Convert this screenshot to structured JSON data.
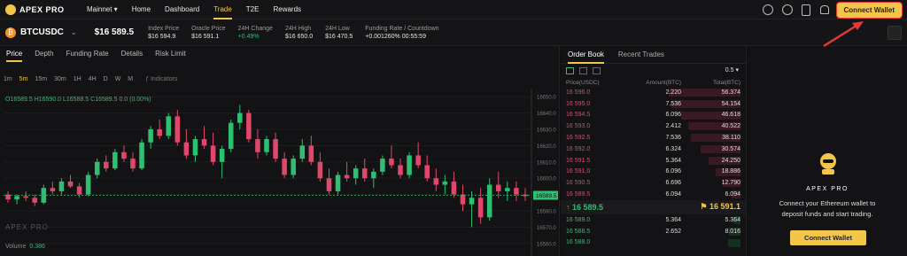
{
  "nav": {
    "logo": "APEX PRO",
    "items": [
      {
        "label": "Mainnet ▾",
        "active": false
      },
      {
        "label": "Home",
        "active": false
      },
      {
        "label": "Dashboard",
        "active": false
      },
      {
        "label": "Trade",
        "active": true
      },
      {
        "label": "T2E",
        "active": false
      },
      {
        "label": "Rewards",
        "active": false
      }
    ],
    "connect_label": "Connect Wallet"
  },
  "ticker": {
    "symbol": "BTCUSDC",
    "price": "$16 589.5",
    "stats": [
      {
        "k": "Index Price",
        "v": "$16 594.9",
        "green": false
      },
      {
        "k": "Oracle Price",
        "v": "$16 591.1",
        "green": false
      },
      {
        "k": "24H Change",
        "v": "+0.49%",
        "green": true
      },
      {
        "k": "24H High",
        "v": "$16 650.0",
        "green": false
      },
      {
        "k": "24H Low",
        "v": "$16 470.5",
        "green": false
      },
      {
        "k": "Funding Rate / Countdown",
        "v": "+0.001260%  00:55:59",
        "green": false
      }
    ]
  },
  "chart": {
    "tabs": [
      "Price",
      "Depth",
      "Funding Rate",
      "Details",
      "Risk Limit"
    ],
    "timeframes": [
      "1m",
      "5m",
      "15m",
      "30m",
      "1H",
      "4H",
      "D",
      "W",
      "M"
    ],
    "active_tf": "5m",
    "indicators_label": "Indicators",
    "ohlc": "O16589.5  H16590.0  L16588.5  C16589.5  0.0 (0.00%)",
    "watermark": "APEX PRO",
    "volume_label": "Volume",
    "volume_value": "0.386",
    "current_price_tag": "16589.5"
  },
  "chart_data": {
    "type": "candlestick",
    "y_ticks": [
      "16650.0",
      "16640.0",
      "16630.0",
      "16620.0",
      "16610.0",
      "16600.0",
      "16590.0",
      "16580.0",
      "16570.0",
      "16560.0"
    ],
    "ylim": [
      16555,
      16655
    ],
    "candles": [
      [
        16590,
        16592,
        16585,
        16587
      ],
      [
        16587,
        16590,
        16584,
        16589
      ],
      [
        16589,
        16592,
        16586,
        16588
      ],
      [
        16588,
        16590,
        16583,
        16585
      ],
      [
        16585,
        16596,
        16584,
        16594
      ],
      [
        16594,
        16598,
        16590,
        16592
      ],
      [
        16592,
        16600,
        16590,
        16598
      ],
      [
        16598,
        16602,
        16594,
        16595
      ],
      [
        16595,
        16597,
        16588,
        16590
      ],
      [
        16590,
        16604,
        16589,
        16602
      ],
      [
        16602,
        16612,
        16600,
        16610
      ],
      [
        16610,
        16614,
        16604,
        16606
      ],
      [
        16606,
        16618,
        16605,
        16616
      ],
      [
        16616,
        16620,
        16610,
        16612
      ],
      [
        16612,
        16616,
        16604,
        16606
      ],
      [
        16606,
        16624,
        16605,
        16622
      ],
      [
        16622,
        16632,
        16618,
        16630
      ],
      [
        16630,
        16636,
        16624,
        16626
      ],
      [
        16626,
        16640,
        16624,
        16638
      ],
      [
        16638,
        16642,
        16620,
        16622
      ],
      [
        16622,
        16630,
        16612,
        16614
      ],
      [
        16614,
        16626,
        16610,
        16624
      ],
      [
        16624,
        16632,
        16618,
        16620
      ],
      [
        16620,
        16628,
        16608,
        16610
      ],
      [
        16610,
        16620,
        16600,
        16618
      ],
      [
        16618,
        16636,
        16616,
        16634
      ],
      [
        16634,
        16645,
        16630,
        16640
      ],
      [
        16640,
        16642,
        16622,
        16624
      ],
      [
        16624,
        16630,
        16612,
        16616
      ],
      [
        16616,
        16626,
        16614,
        16624
      ],
      [
        16624,
        16628,
        16610,
        16612
      ],
      [
        16612,
        16616,
        16600,
        16602
      ],
      [
        16602,
        16614,
        16600,
        16612
      ],
      [
        16612,
        16624,
        16610,
        16620
      ],
      [
        16620,
        16626,
        16608,
        16610
      ],
      [
        16610,
        16616,
        16598,
        16600
      ],
      [
        16600,
        16606,
        16590,
        16592
      ],
      [
        16592,
        16604,
        16590,
        16602
      ],
      [
        16602,
        16610,
        16598,
        16600
      ],
      [
        16600,
        16608,
        16596,
        16606
      ],
      [
        16606,
        16612,
        16598,
        16600
      ],
      [
        16600,
        16606,
        16594,
        16604
      ],
      [
        16604,
        16614,
        16602,
        16612
      ],
      [
        16612,
        16620,
        16606,
        16608
      ],
      [
        16608,
        16612,
        16600,
        16602
      ],
      [
        16602,
        16616,
        16600,
        16614
      ],
      [
        16614,
        16622,
        16606,
        16608
      ],
      [
        16608,
        16614,
        16598,
        16600
      ],
      [
        16600,
        16606,
        16592,
        16596
      ],
      [
        16596,
        16602,
        16590,
        16598
      ],
      [
        16598,
        16604,
        16588,
        16590
      ],
      [
        16590,
        16596,
        16580,
        16584
      ],
      [
        16584,
        16592,
        16570,
        16588
      ],
      [
        16588,
        16594,
        16572,
        16576
      ],
      [
        16576,
        16600,
        16574,
        16596
      ],
      [
        16596,
        16604,
        16588,
        16592
      ],
      [
        16592,
        16598,
        16586,
        16594
      ],
      [
        16594,
        16598,
        16586,
        16590
      ],
      [
        16590,
        16594,
        16586,
        16589
      ]
    ]
  },
  "orderbook": {
    "tabs": [
      "Order Book",
      "Recent Trades"
    ],
    "precision": "0.5 ▾",
    "headers": [
      "Price(USDC)",
      "Amount(BTC)",
      "Total(BTC)"
    ],
    "asks": [
      [
        "16 596.0",
        "2.220",
        "56.374",
        0.58
      ],
      [
        "16 595.0",
        "7.536",
        "54.154",
        0.56
      ],
      [
        "16 594.5",
        "6.096",
        "46.618",
        0.48
      ],
      [
        "16 593.0",
        "2.412",
        "40.522",
        0.42
      ],
      [
        "16 592.5",
        "7.536",
        "38.110",
        0.4
      ],
      [
        "16 592.0",
        "6.324",
        "30.574",
        0.32
      ],
      [
        "16 591.5",
        "5.364",
        "24.250",
        0.26
      ],
      [
        "16 591.0",
        "6.096",
        "18.886",
        0.2
      ],
      [
        "16 590.5",
        "6.696",
        "12.790",
        0.14
      ],
      [
        "16 589.5",
        "6.094",
        "6.094",
        0.07
      ]
    ],
    "mid_left": "↑ 16 589.5",
    "mid_right": "⚑ 16 591.1",
    "bids": [
      [
        "16 589.0",
        "5.364",
        "5.364",
        0.06
      ],
      [
        "16 588.5",
        "2.652",
        "8.016",
        0.09
      ],
      [
        "16 588.0",
        "",
        "",
        0.1
      ]
    ]
  },
  "wallet": {
    "brand": "APEX PRO",
    "text_line1": "Connect your Ethereum wallet to",
    "text_line2": "deposit funds and start trading.",
    "button": "Connect Wallet"
  },
  "colors": {
    "accent": "#f3c64a",
    "up": "#2fbf71",
    "down": "#e0486b"
  }
}
